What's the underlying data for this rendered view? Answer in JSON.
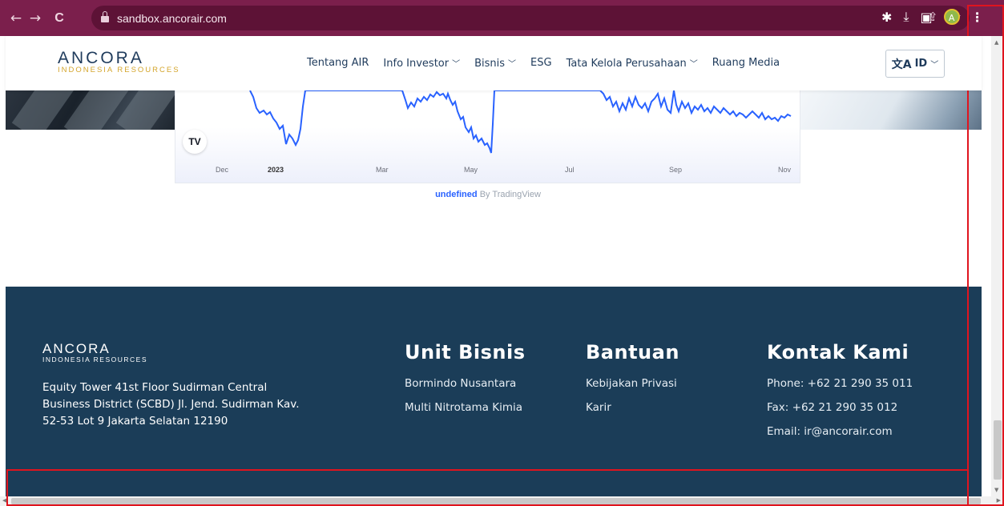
{
  "browser": {
    "url": "sandbox.ancorair.com",
    "avatar_letter": "A",
    "nav": {
      "back": "←",
      "forward": "→",
      "reload": "C"
    }
  },
  "header": {
    "logo_main": "ANCORA",
    "logo_sub": "INDONESIA RESOURCES",
    "nav_items": [
      {
        "label": "Tentang AIR",
        "has_dropdown": false
      },
      {
        "label": "Info Investor",
        "has_dropdown": true
      },
      {
        "label": "Bisnis",
        "has_dropdown": true
      },
      {
        "label": "ESG",
        "has_dropdown": false
      },
      {
        "label": "Tata Kelola Perusahaan",
        "has_dropdown": true
      },
      {
        "label": "Ruang Media",
        "has_dropdown": false
      }
    ],
    "language": "ID"
  },
  "chart": {
    "badge": "TV",
    "x_ticks": [
      "Dec",
      "2023",
      "Mar",
      "May",
      "Jul",
      "Sep",
      "Nov"
    ],
    "credit_link": "undefined",
    "credit_text": "By TradingView"
  },
  "chart_data": {
    "type": "line",
    "title": "",
    "xlabel": "",
    "ylabel": "",
    "x": [
      "Dec",
      "2023",
      "Mar",
      "May",
      "Jul",
      "Sep",
      "Nov"
    ],
    "series": [
      {
        "values": []
      }
    ]
  },
  "footer": {
    "logo_main": "ANCORA",
    "logo_sub": "INDONESIA RESOURCES",
    "address": "Equity Tower 41st Floor Sudirman Central Business District (SCBD) Jl. Jend. Sudirman Kav. 52-53 Lot 9 Jakarta Selatan 12190",
    "unit_bisnis": {
      "title": "Unit Bisnis",
      "links": [
        "Bormindo Nusantara",
        "Multi Nitrotama Kimia"
      ]
    },
    "bantuan": {
      "title": "Bantuan",
      "links": [
        "Kebijakan Privasi",
        "Karir"
      ]
    },
    "kontak": {
      "title": "Kontak Kami",
      "phone": "Phone: +62 21 290 35 011",
      "fax": "Fax: +62 21 290 35 012",
      "email": "Email: ir@ancorair.com"
    }
  }
}
